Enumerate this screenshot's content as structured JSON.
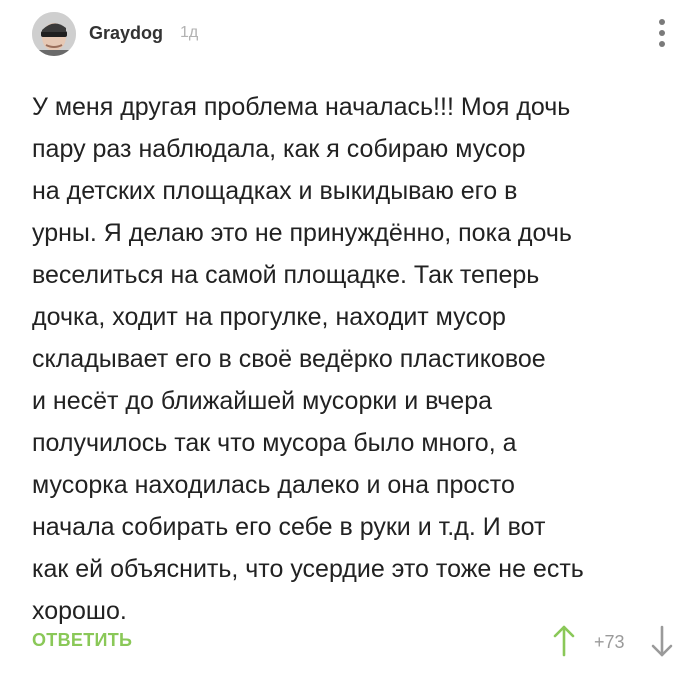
{
  "comment": {
    "author": "Graydog",
    "time_ago": "1д",
    "text": "У меня другая проблема началась!!! Моя дочь\nпару раз наблюдала, как я собираю мусор\nна детских площадках и выкидываю его в\nурны. Я делаю это не принуждённо, пока дочь\nвеселиться на самой площадке. Так теперь\nдочка, ходит на прогулке, находит мусор\nскладывает его в своё ведёрко пластиковое\nи несёт до ближайшей мусорки и вчера\nполучилось так что мусора было много, а\nмусорка находилась далеко и она просто\nначала собирать его себе в руки и т.д. И вот\nкак ей объяснить, что усердие это тоже не есть\nхорошо.",
    "reply_label": "ОТВЕТИТЬ",
    "rating": "+73"
  },
  "colors": {
    "accent_green": "#8ac858",
    "muted_gray": "#9a9a9a",
    "icon_gray": "#7a7a7a"
  },
  "icons": {
    "more": "vertical-dots-icon",
    "upvote": "arrow-up-icon",
    "downvote": "arrow-down-icon"
  }
}
